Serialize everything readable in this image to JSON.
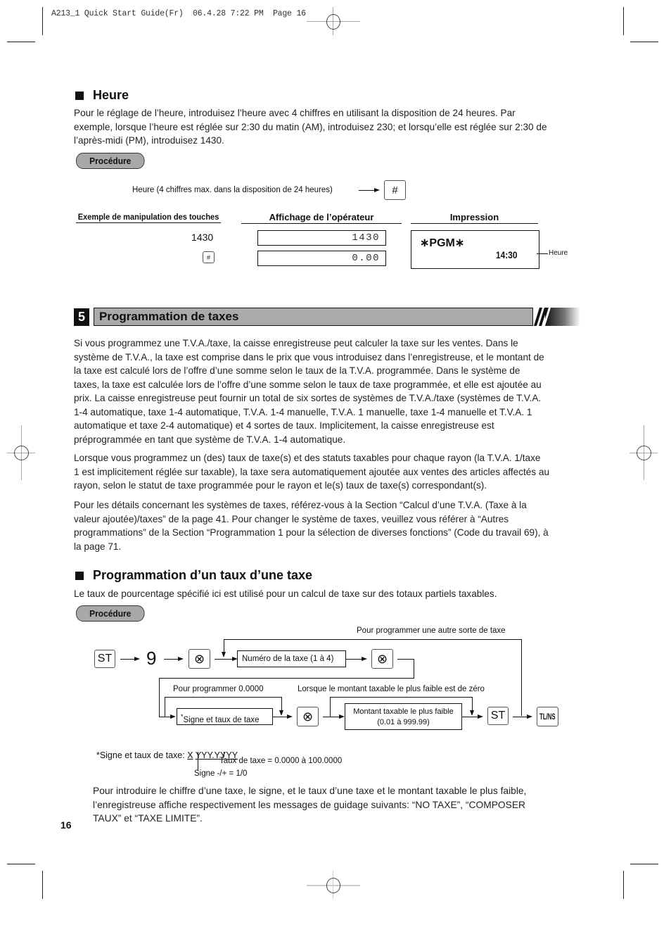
{
  "slug": "A213_1 Quick Start Guide(Fr)  06.4.28 7:22 PM  Page 16",
  "heure": {
    "title": "Heure",
    "lines": [
      "Pour le réglage de l’heure, introduisez l’heure avec 4 chiffres en utilisant la disposition de 24 heures. Par",
      "exemple, lorsque l’heure est réglée sur 2:30 du matin (AM), introduisez 230; et lorsqu’elle est réglée sur 2:30 de",
      "l’après-midi (PM), introduisez 1430."
    ],
    "procedure_label": "Procédure",
    "procedure_step": "Heure (4 chiffres max. dans la disposition de 24 heures)",
    "procedure_key": "#",
    "example": {
      "col_keys": "Exemple de manipulation des touches",
      "col_display": "Affichage de l’opérateur",
      "col_print": "Impression",
      "key_entry": "1430",
      "key_button": "#",
      "display_1": "1430",
      "display_2": "0.00",
      "print_header": "∗PGM∗",
      "print_time": "14:30",
      "print_annotation": "Heure"
    }
  },
  "section5": {
    "number": "5",
    "title": "Programmation de taxes",
    "para1": [
      "Si vous programmez une T.V.A./taxe, la caisse enregistreuse peut calculer la taxe sur les ventes. Dans le",
      "système de T.V.A., la taxe est comprise dans le prix que vous introduisez dans l’enregistreuse, et le montant de",
      "la taxe est calculé lors de l’offre d’une somme selon le taux de la T.V.A. programmée. Dans le système de",
      "taxes, la taxe est calculée lors de l’offre d’une somme selon le taux de taxe programmée, et elle est ajoutée au",
      "prix. La caisse enregistreuse peut fournir un total de six sortes de systèmes de T.V.A./taxe (systèmes de T.V.A.",
      "1-4 automatique, taxe 1-4 automatique, T.V.A. 1-4 manuelle, T.V.A. 1 manuelle, taxe 1-4 manuelle et T.V.A. 1",
      "automatique et taxe 2-4 automatique) et 4 sortes de taux. Implicitement, la caisse enregistreuse est",
      "préprogrammée en tant que système de T.V.A. 1-4 automatique."
    ],
    "para2": [
      "Lorsque vous programmez un (des) taux de taxe(s) et des statuts taxables pour chaque rayon (la T.V.A. 1/taxe",
      "1 est implicitement réglée sur taxable), la taxe sera automatiquement ajoutée aux ventes des articles affectés au",
      "rayon, selon le statut de taxe programmée pour le rayon et le(s) taux de taxe(s) correspondant(s)."
    ],
    "para3": [
      "Pour les détails concernant les systèmes de taxes, référez-vous à la Section “Calcul d’une T.V.A. (Taxe à la",
      "valeur ajoutée)/taxes” de la page 41. Pour changer le système de taxes, veuillez vous référer à “Autres",
      "programmations” de la Section “Programmation 1 pour la sélection de diverses fonctions” (Code du travail 69), à",
      "la page 71."
    ]
  },
  "taux": {
    "title": "Programmation d’un taux d’une taxe",
    "intro": "Le taux de pourcentage spécifié ici est utilisé pour un calcul de taxe sur des totaux partiels taxables.",
    "procedure_label": "Procédure",
    "flow": {
      "key_st": "ST",
      "digit": "9",
      "key_mult": "⊗",
      "box_tax_number": "Numéro de la taxe (1 à 4)",
      "loop_label": "Pour programmer une autre sorte de taxe",
      "skip_rate_label": "Pour programmer 0.0000",
      "box_sign_rate_star": "*",
      "box_sign_rate": "Signe et taux de taxe",
      "skip_min_label": "Lorsque le montant taxable le plus faible est de zéro",
      "box_min_1": "Montant taxable le plus faible",
      "box_min_2": "(0.01 à 999.99)",
      "key_st2": "ST",
      "key_tlns": "TL/NS"
    },
    "format": {
      "label": "*Signe et taux de taxe: ",
      "x": "X",
      "y": "YYY.YYYY",
      "rate_note": "Taux de taxe = 0.0000 à 100.0000",
      "sign_note": "Signe -/+ = 1/0"
    },
    "closing": [
      "Pour introduire le chiffre d’une taxe, le signe, et le taux d’une taxe et le montant taxable le plus faible,",
      "l’enregistreuse affiche respectivement les messages de guidage suivants: “NO TAXE”, “COMPOSER",
      "TAUX” et “TAXE LIMITE”."
    ]
  },
  "page_number": "16"
}
